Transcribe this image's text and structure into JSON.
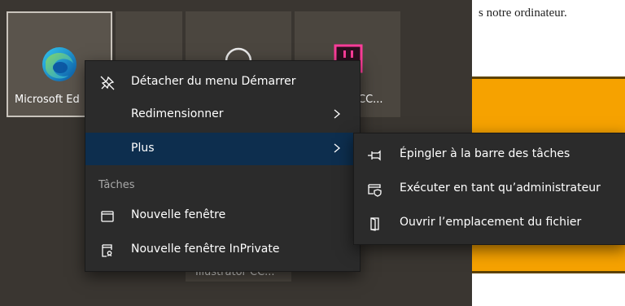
{
  "document": {
    "text_fragment": "s notre ordinateur."
  },
  "tiles": {
    "edge_label": "Microsoft Ed",
    "cc_label": "CC...",
    "illustrator_label": "Illustrator CC..."
  },
  "context_menu": {
    "items": [
      {
        "label": "Détacher du menu Démarrer",
        "icon": "unpin-icon"
      },
      {
        "label": "Redimensionner",
        "icon": "",
        "has_submenu": true
      },
      {
        "label": "Plus",
        "icon": "",
        "has_submenu": true,
        "active": true
      }
    ],
    "section_title": "Tâches",
    "tasks": [
      {
        "label": "Nouvelle fenêtre",
        "icon": "window-icon"
      },
      {
        "label": "Nouvelle fenêtre InPrivate",
        "icon": "inprivate-window-icon"
      }
    ]
  },
  "submenu": {
    "items": [
      {
        "label": "Épingler à la barre des tâches",
        "icon": "pin-taskbar-icon"
      },
      {
        "label": "Exécuter en tant qu’administrateur",
        "icon": "run-admin-icon"
      },
      {
        "label": "Ouvrir l’emplacement du fichier",
        "icon": "open-location-icon"
      }
    ]
  },
  "colors": {
    "menu_bg": "#2b2b2b",
    "active_item": "#0d2e4e",
    "orange_panel": "#f6a200",
    "start_bg": "#3a3631"
  }
}
